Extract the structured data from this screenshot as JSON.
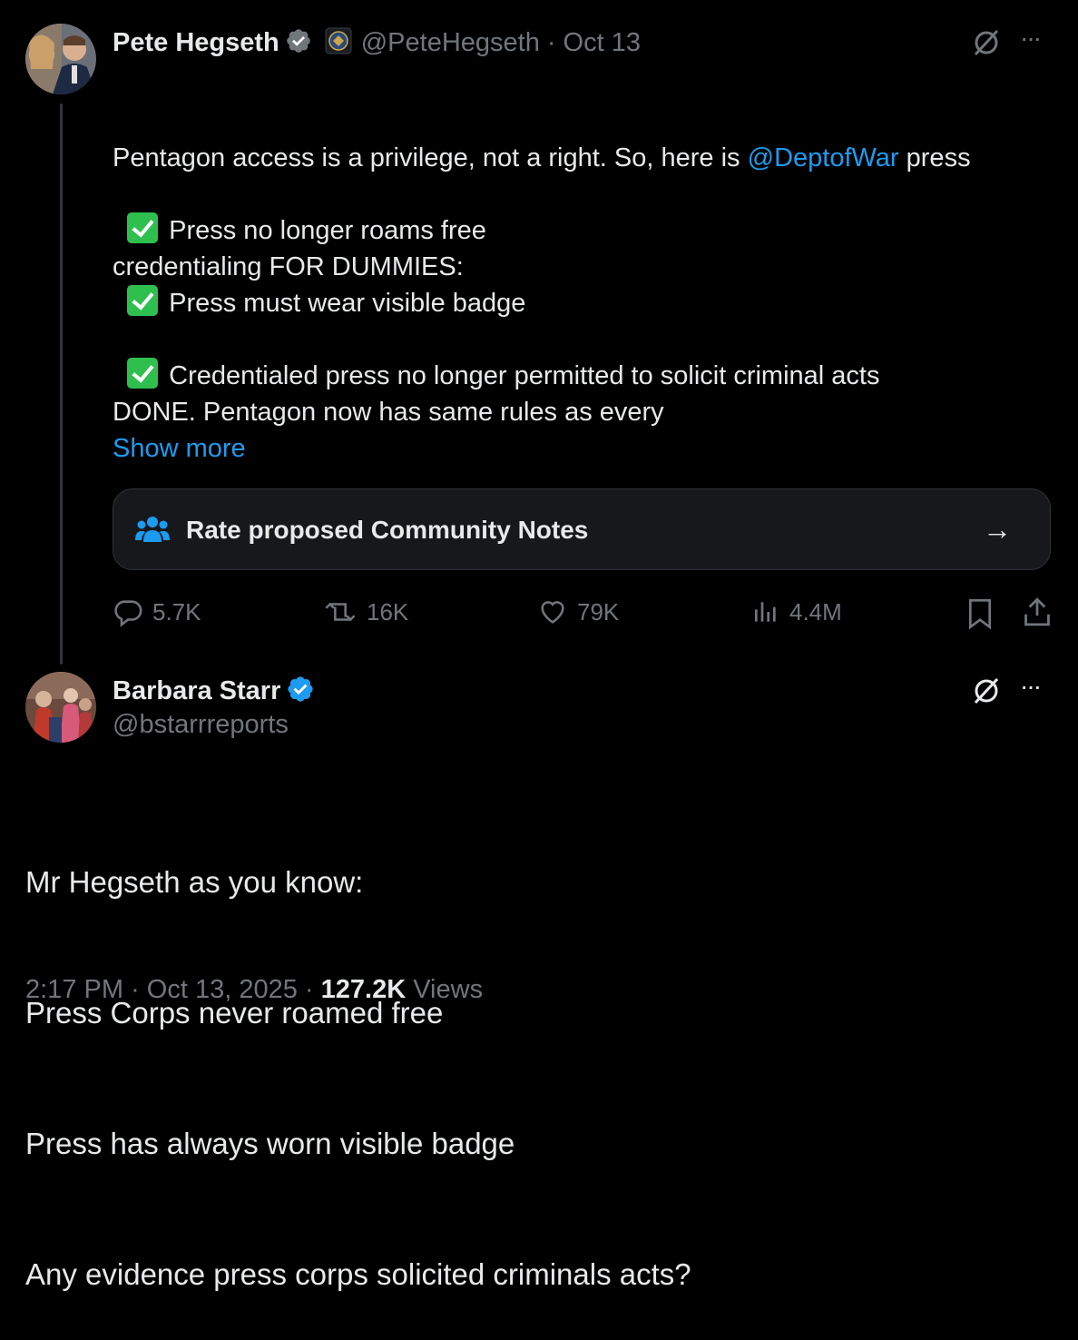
{
  "tweet": {
    "author_name": "Pete Hegseth",
    "handle": "@PeteHegseth",
    "separator": "·",
    "date": "Oct 13",
    "text_line1_pre": "Pentagon access is a privilege, not a right. So, here is ",
    "text_mention": "@DeptofWar",
    "text_line1_post": " press",
    "text_line2": "credentialing FOR DUMMIES:",
    "bullet1": "Press no longer roams free",
    "bullet2": "Press must wear visible badge",
    "bullet3": "Credentialed press no longer permitted to solicit criminal acts",
    "text_done": "DONE. Pentagon now has same rules as every",
    "show_more": "Show more",
    "community_notes_label": "Rate proposed Community Notes",
    "community_notes_arrow": "→",
    "replies": "5.7K",
    "reposts": "16K",
    "likes": "79K",
    "views": "4.4M",
    "more_label": "···"
  },
  "reply": {
    "author_name": "Barbara Starr",
    "handle": "@bstarrreports",
    "more_label": "···",
    "line1": "Mr Hegseth as you know:",
    "line2": "Press Corps never roamed free",
    "line3": "Press has always worn visible badge",
    "line4": "Any evidence press corps solicited criminals acts?",
    "time": "2:17 PM",
    "separator": "·",
    "date": "Oct 13, 2025",
    "separator2": "·",
    "views_count": "127.2K",
    "views_label": "Views"
  },
  "colors": {
    "background": "#000000",
    "text": "#e7e9ea",
    "muted": "#71767b",
    "link": "#1d9bf0",
    "verified": "#1d9bf0",
    "check": "#2fbf4f"
  },
  "icons": [
    "verified-badge-icon",
    "dod-seal-icon",
    "grok-icon",
    "more-icon",
    "community-icon",
    "arrow-right-icon",
    "reply-icon",
    "repost-icon",
    "like-icon",
    "views-icon",
    "bookmark-icon",
    "share-icon",
    "check-icon"
  ]
}
